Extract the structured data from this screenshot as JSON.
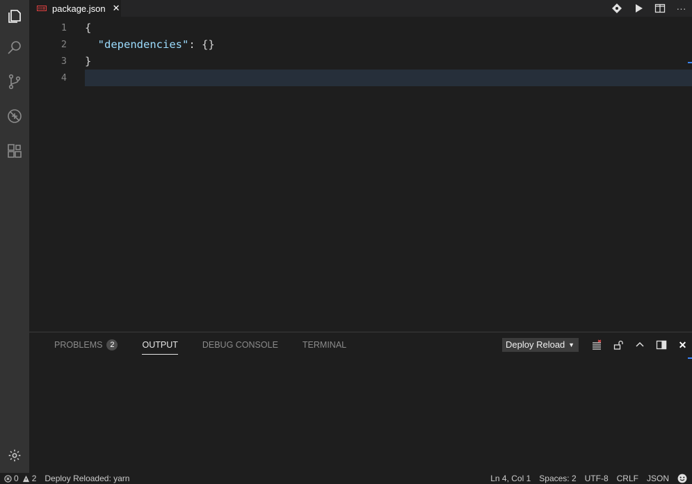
{
  "editor_tab": {
    "filename": "package.json",
    "close_glyph": "✕",
    "icon": "json-file-icon"
  },
  "editor_actions": [
    {
      "name": "git-compare-icon"
    },
    {
      "name": "run-icon"
    },
    {
      "name": "split-editor-icon"
    },
    {
      "name": "more-actions-icon",
      "glyph": "···"
    }
  ],
  "activity_bar": [
    {
      "name": "explorer-icon"
    },
    {
      "name": "search-icon"
    },
    {
      "name": "source-control-icon"
    },
    {
      "name": "debug-icon"
    },
    {
      "name": "extensions-icon"
    }
  ],
  "code": {
    "lines": [
      {
        "number": "1",
        "text": "{"
      },
      {
        "number": "2",
        "indent": "  ",
        "key": "\"dependencies\"",
        "rest": ": {}"
      },
      {
        "number": "3",
        "text": "}"
      },
      {
        "number": "4",
        "text": ""
      }
    ],
    "current_line": 4
  },
  "panel": {
    "tabs": [
      {
        "label": "PROBLEMS",
        "badge": "2"
      },
      {
        "label": "OUTPUT",
        "active": true
      },
      {
        "label": "DEBUG CONSOLE"
      },
      {
        "label": "TERMINAL"
      }
    ],
    "output_channel": "Deploy Reload",
    "select_arrow": "▼",
    "actions": [
      {
        "name": "clear-output-icon"
      },
      {
        "name": "lock-scroll-icon"
      },
      {
        "name": "maximize-panel-icon"
      },
      {
        "name": "toggle-panel-position-icon"
      },
      {
        "name": "close-panel-icon",
        "glyph": "✕"
      }
    ]
  },
  "status_bar": {
    "errors": "0",
    "warnings": "2",
    "message": "Deploy Reloaded: yarn",
    "cursor_position": "Ln 4, Col 1",
    "indentation": "Spaces: 2",
    "encoding": "UTF-8",
    "line_endings": "CRLF",
    "language": "JSON"
  },
  "colors": {
    "accent": "#3a86ff",
    "json_key": "#9cdcfe",
    "activity_bar": "#333333",
    "editor_bg": "#1e1e1e"
  }
}
